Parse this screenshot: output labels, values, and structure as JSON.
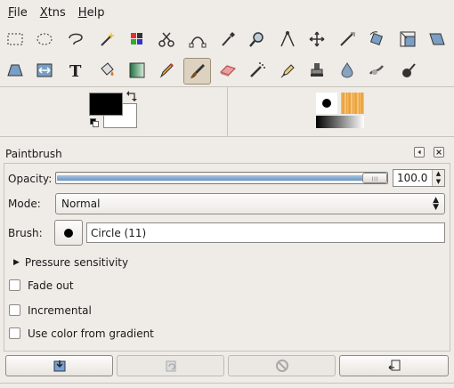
{
  "menubar": {
    "items": [
      {
        "label": "File",
        "mnemonic": "F",
        "rest": "ile"
      },
      {
        "label": "Xtns",
        "mnemonic": "X",
        "rest": "tns"
      },
      {
        "label": "Help",
        "mnemonic": "H",
        "rest": "elp"
      }
    ]
  },
  "toolbox": {
    "row1": [
      "rect-select-icon",
      "ellipse-select-icon",
      "free-select-icon",
      "fuzzy-select-icon",
      "select-by-color-icon",
      "scissors-select-icon",
      "paths-icon",
      "color-picker-icon",
      "zoom-icon",
      "measure-icon",
      "move-icon",
      "crop-icon",
      "rotate-icon",
      "scale-icon",
      "shear-icon"
    ],
    "row2": [
      "perspective-icon",
      "flip-icon",
      "text-icon",
      "bucket-fill-icon",
      "blend-icon",
      "pencil-icon",
      "paintbrush-icon",
      "eraser-icon",
      "airbrush-icon",
      "ink-icon",
      "clone-icon",
      "heal-icon",
      "smudge-icon",
      "dodge-burn-icon"
    ],
    "active_tool": "paintbrush-icon"
  },
  "colors": {
    "foreground": "#000000",
    "background": "#ffffff"
  },
  "tool_options": {
    "title": "Paintbrush",
    "opacity_label": "Opacity:",
    "opacity_value": "100.0",
    "opacity_fraction": 1.0,
    "mode_label": "Mode:",
    "mode_value": "Normal",
    "brush_label": "Brush:",
    "brush_value": "Circle (11)",
    "pressure_label": "Pressure sensitivity",
    "fade_out_label": "Fade out",
    "incremental_label": "Incremental",
    "use_gradient_label": "Use color from gradient"
  },
  "bottom_buttons": [
    "save-options-icon",
    "restore-options-icon",
    "delete-options-icon",
    "reset-options-icon"
  ]
}
